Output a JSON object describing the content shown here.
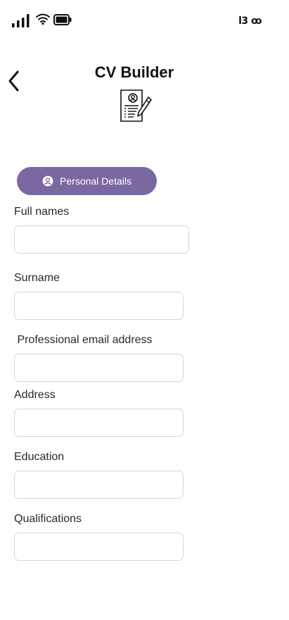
{
  "status_bar": {
    "time": "13:00",
    "time_display": "l3 ꝏ",
    "icons": [
      "signal-icon",
      "wifi-icon",
      "battery-icon"
    ]
  },
  "header": {
    "title": "CV Builder",
    "back_icon": "chevron-left-icon",
    "logo_icon": "cv-document-icon"
  },
  "section_tab": {
    "label": "Personal Details",
    "icon": "user-circle-icon",
    "color": "#7a69a1"
  },
  "form": {
    "fields": [
      {
        "label": "Full names",
        "value": "",
        "placeholder": ""
      },
      {
        "label": "Surname",
        "value": "",
        "placeholder": ""
      },
      {
        "label": " Professional email address",
        "value": "",
        "placeholder": ""
      },
      {
        "label": "Address",
        "value": "",
        "placeholder": ""
      },
      {
        "label": "Education",
        "value": "",
        "placeholder": ""
      },
      {
        "label": "Qualifications",
        "value": "",
        "placeholder": ""
      }
    ]
  }
}
